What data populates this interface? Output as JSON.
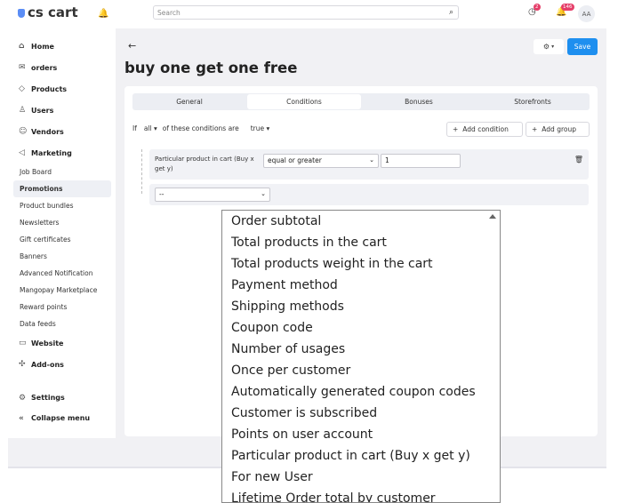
{
  "app": {
    "logo": "cs cart"
  },
  "sidebar": {
    "items": [
      {
        "label": "Home",
        "icon": "home-icon",
        "glyph": "⌂",
        "kind": "main"
      },
      {
        "label": "orders",
        "icon": "inbox-icon",
        "glyph": "✉",
        "kind": "main"
      },
      {
        "label": "Products",
        "icon": "tag-icon",
        "glyph": "◇",
        "kind": "main"
      },
      {
        "label": "Users",
        "icon": "user-icon",
        "glyph": "♙",
        "kind": "main"
      },
      {
        "label": "Vendors",
        "icon": "people-icon",
        "glyph": "☺",
        "kind": "main"
      },
      {
        "label": "Marketing",
        "icon": "megaphone-icon",
        "glyph": "◁",
        "kind": "main"
      },
      {
        "label": "Job Board",
        "kind": "sub"
      },
      {
        "label": "Promotions",
        "kind": "sub",
        "active": true
      },
      {
        "label": "Product bundles",
        "kind": "sub"
      },
      {
        "label": "Newsletters",
        "kind": "sub"
      },
      {
        "label": "Gift certificates",
        "kind": "sub"
      },
      {
        "label": "Banners",
        "kind": "sub"
      },
      {
        "label": "Advanced Notification",
        "kind": "sub"
      },
      {
        "label": "Mangopay Marketplace",
        "kind": "sub"
      },
      {
        "label": "Reward points",
        "kind": "sub"
      },
      {
        "label": "Data feeds",
        "kind": "sub"
      },
      {
        "label": "Website",
        "icon": "monitor-icon",
        "glyph": "▭",
        "kind": "main"
      },
      {
        "label": "Add-ons",
        "icon": "puzzle-icon",
        "glyph": "✣",
        "kind": "main"
      }
    ],
    "settings": "Settings",
    "collapse": "Collapse menu"
  },
  "topbar": {
    "search_placeholder": "Search",
    "notif_badge": "2",
    "bell_badge": "146",
    "avatar": "AA"
  },
  "page": {
    "title": "buy one get one free",
    "save": "Save"
  },
  "tabs": [
    {
      "label": "General",
      "active": false
    },
    {
      "label": "Conditions",
      "active": true
    },
    {
      "label": "Bonuses",
      "active": false
    },
    {
      "label": "Storefronts",
      "active": false
    }
  ],
  "conditions": {
    "if": "If",
    "match": "all",
    "of_text": "of these conditions are",
    "value": "true",
    "add_condition": "Add condition",
    "add_group": "Add group",
    "rule_label": "Particular product in cart (Buy x get y)",
    "operator": "equal or greater",
    "rule_value": "1",
    "new_select": "--"
  },
  "dropdown": {
    "options": [
      "Order subtotal",
      "Total products in the cart",
      "Total products weight in the cart",
      "Payment method",
      "Shipping methods",
      "Coupon code",
      "Number of usages",
      "Once per customer",
      "Automatically generated coupon codes",
      "Customer is subscribed",
      "Points on user account",
      "Particular product in cart (Buy x get y)",
      "For new User",
      "Lifetime Order total by customer"
    ]
  }
}
